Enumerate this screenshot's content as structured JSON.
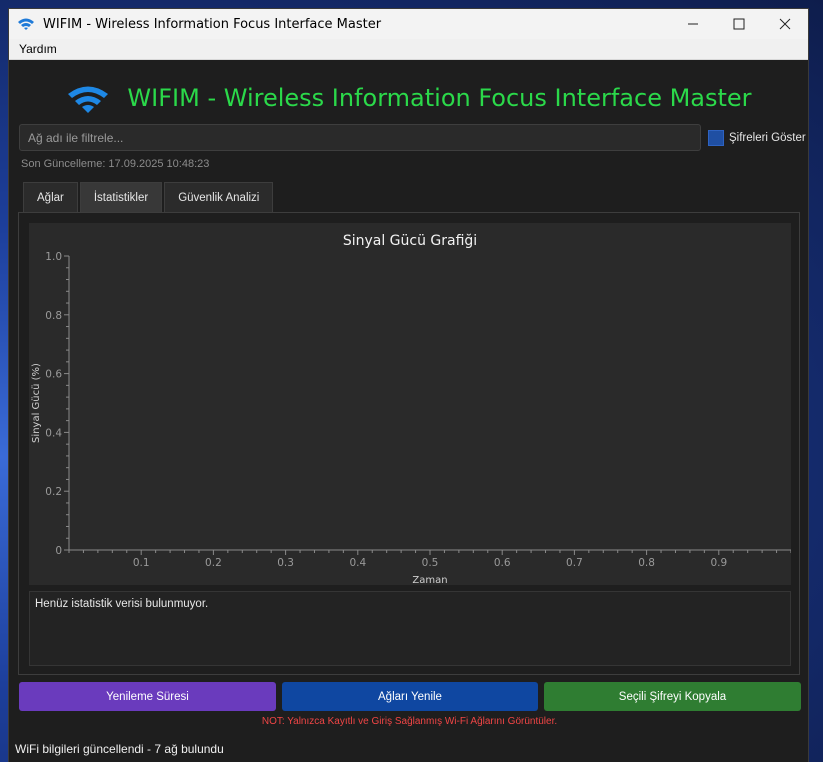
{
  "window": {
    "title": "WIFIM - Wireless Information Focus Interface Master"
  },
  "menu": {
    "items": [
      "Yardım"
    ]
  },
  "header": {
    "title": "WIFIM - Wireless Information Focus Interface Master"
  },
  "filter": {
    "placeholder": "Ağ adı ile filtrele...",
    "value": ""
  },
  "show_passwords": {
    "label": "Şifreleri Göster",
    "checked": true
  },
  "last_update": "Son Güncelleme: 17.09.2025 10:48:23",
  "tabs": [
    {
      "label": "Ağlar",
      "active": false
    },
    {
      "label": "İstatistikler",
      "active": true
    },
    {
      "label": "Güvenlik Analizi",
      "active": false
    }
  ],
  "chart_data": {
    "type": "line",
    "title": "Sinyal Gücü Grafiği",
    "xlabel": "Zaman",
    "ylabel": "Sinyal Gücü (%)",
    "xlim": [
      0,
      1
    ],
    "ylim": [
      0,
      1
    ],
    "x_ticks": [
      "0.1",
      "0.2",
      "0.3",
      "0.4",
      "0.5",
      "0.6",
      "0.7",
      "0.8",
      "0.9"
    ],
    "y_ticks": [
      "0",
      "0.2",
      "0.4",
      "0.6",
      "0.8",
      "1.0"
    ],
    "series": [],
    "grid": false
  },
  "stats": {
    "message": "Henüz istatistik verisi bulunmuyor."
  },
  "buttons": {
    "refresh_interval": "Yenileme Süresi",
    "refresh_networks": "Ağları Yenile",
    "copy_password": "Seçili Şifreyi Kopyala"
  },
  "note": "NOT: Yalnızca Kayıtlı ve Giriş Sağlanmış Wi-Fi Ağlarını Görüntüler.",
  "status": "WiFi bilgileri güncellendi - 7 ağ bulundu",
  "colors": {
    "accent_green": "#2bd94a",
    "purple_button": "#6a3bbd",
    "blue_button": "#0f47a1",
    "green_button": "#2f7d32",
    "note_red": "#f04545"
  }
}
